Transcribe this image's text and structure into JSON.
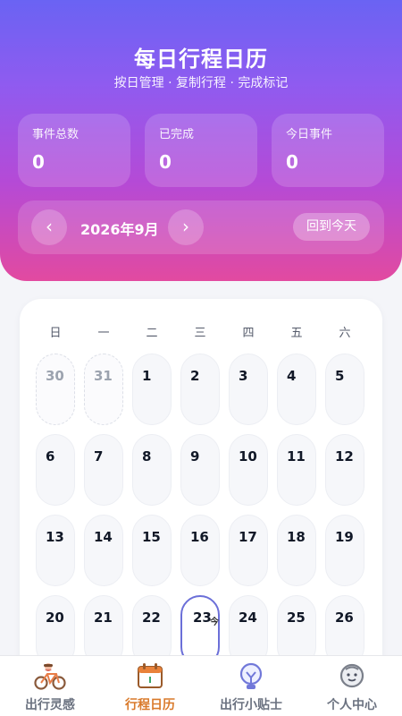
{
  "header": {
    "title": "每日行程日历",
    "subtitle": "按日管理 · 复制行程 · 完成标记"
  },
  "stats": [
    {
      "label": "事件总数",
      "value": "0"
    },
    {
      "label": "已完成",
      "value": "0"
    },
    {
      "label": "今日事件",
      "value": "0"
    }
  ],
  "month_nav": {
    "prev_icon": "chevron-left",
    "prev_glyph": "‹",
    "month_label": "2026年9月",
    "next_icon": "chevron-right",
    "next_glyph": "›",
    "today_button": "回到今天"
  },
  "calendar": {
    "weekdays": [
      "日",
      "一",
      "二",
      "三",
      "四",
      "五",
      "六"
    ],
    "today_tag": "今",
    "rows": [
      [
        "30",
        "31",
        "1",
        "2",
        "3",
        "4",
        "5"
      ],
      [
        "6",
        "7",
        "8",
        "9",
        "10",
        "11",
        "12"
      ],
      [
        "13",
        "14",
        "15",
        "16",
        "17",
        "18",
        "19"
      ],
      [
        "20",
        "21",
        "22",
        "23",
        "24",
        "25",
        "26"
      ]
    ]
  },
  "tabbar": {
    "items": [
      {
        "label": "出行灵感",
        "icon": "bicycle-icon",
        "active": false
      },
      {
        "label": "行程日历",
        "icon": "calendar-icon",
        "active": true
      },
      {
        "label": "出行小贴士",
        "icon": "lightbulb-icon",
        "active": false
      },
      {
        "label": "个人中心",
        "icon": "profile-face-icon",
        "active": false
      }
    ]
  },
  "colors": {
    "gradient_top": "#6a63f3",
    "gradient_bottom": "#e24aa0",
    "active_tab": "#d97a2b",
    "today_border": "#6b6fd8"
  }
}
